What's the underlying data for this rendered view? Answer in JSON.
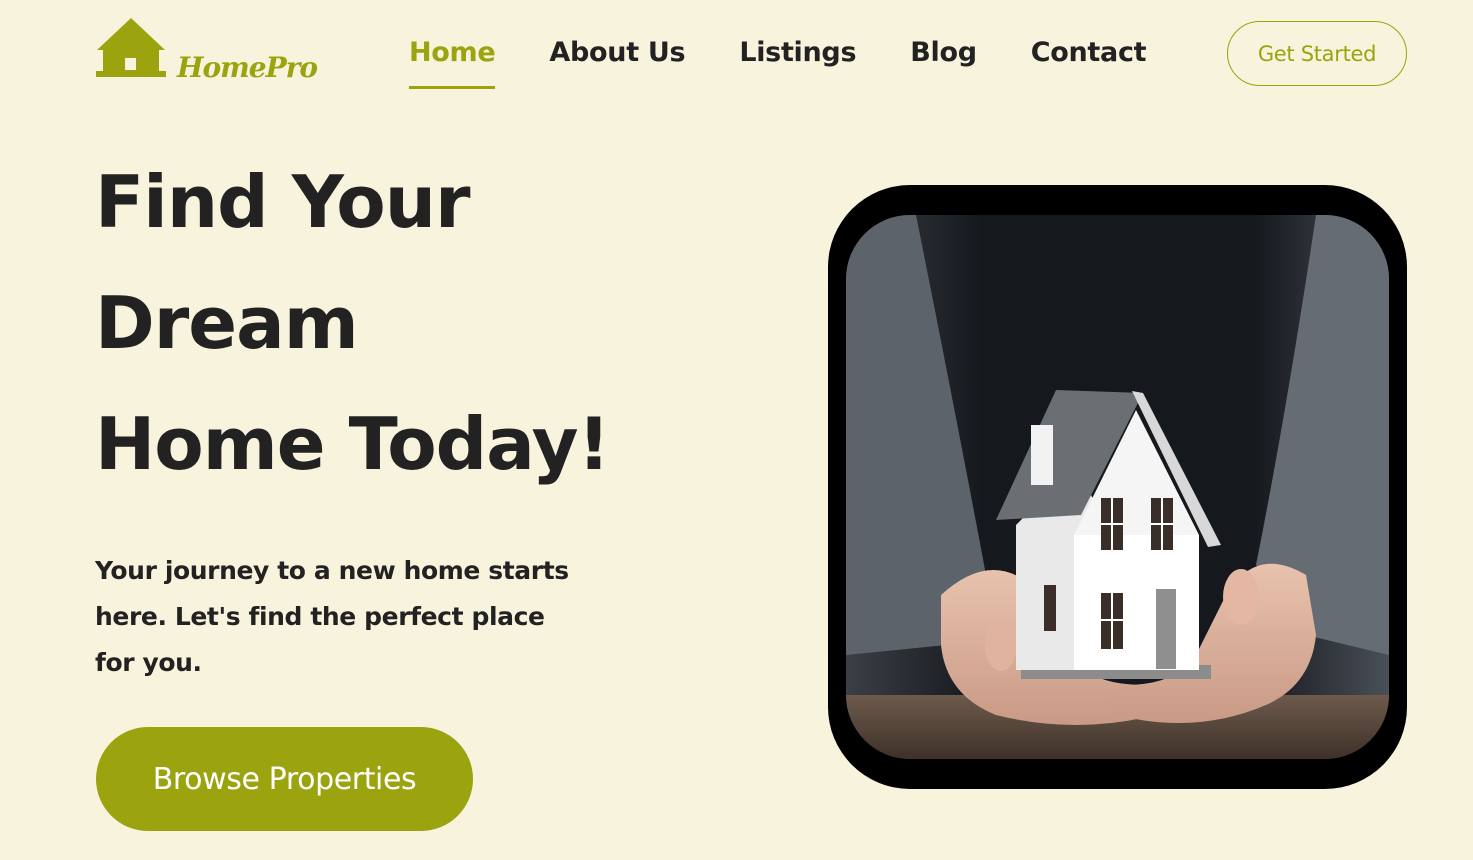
{
  "brand": {
    "name": "HomePro",
    "logo_icon": "house-icon",
    "accent_color": "#9ba30f",
    "background_color": "#f8f3dd"
  },
  "nav": {
    "items": [
      {
        "label": "Home",
        "active": true
      },
      {
        "label": "About Us",
        "active": false
      },
      {
        "label": "Listings",
        "active": false
      },
      {
        "label": "Blog",
        "active": false
      },
      {
        "label": "Contact",
        "active": false
      }
    ],
    "cta_label": "Get Started"
  },
  "hero": {
    "title_lines": [
      "Find Your",
      "Dream",
      "Home Today!"
    ],
    "subtitle": "Your journey to a new home starts here. Let's find the perfect place for you.",
    "button_label": "Browse Properties",
    "image_icon": "hands-holding-house-image"
  }
}
